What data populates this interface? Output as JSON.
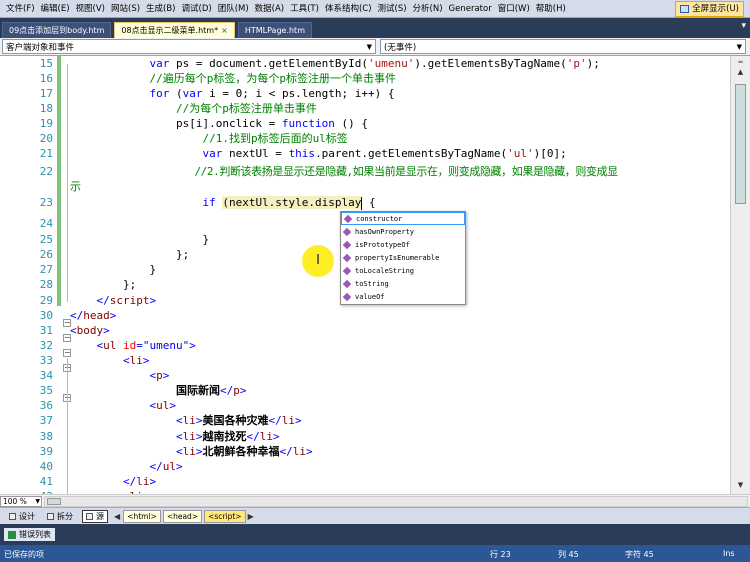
{
  "menubar": {
    "items": [
      "文件(F)",
      "编辑(E)",
      "视图(V)",
      "网站(S)",
      "生成(B)",
      "调试(D)",
      "团队(M)",
      "数据(A)",
      "工具(T)",
      "体系结构(C)",
      "测试(S)",
      "分析(N)",
      "Generator",
      "窗口(W)",
      "帮助(H)"
    ],
    "fullscreen_label": "全屏显示(U)"
  },
  "tabs": {
    "items": [
      {
        "label": "09点击添加层到body.htm"
      },
      {
        "label": "08点击显示二级菜单.htm*",
        "close": "×"
      },
      {
        "label": "HTMLPage.htm"
      }
    ],
    "right_icon": "▾"
  },
  "navbar": {
    "left": "客户端对象和事件",
    "right": "(无事件)"
  },
  "editor": {
    "line_numbers": [
      "15",
      "16",
      "17",
      "18",
      "19",
      "20",
      "21",
      "22",
      "",
      "23",
      "24",
      "25",
      "26",
      "27",
      "28",
      "29",
      "30",
      "31",
      "32",
      "33",
      "34",
      "35",
      "36",
      "37",
      "38",
      "39",
      "40",
      "41",
      "42"
    ],
    "lines": {
      "l15a": "            var ",
      "l15b": "ps = document.getElementById(",
      "l15c": "'umenu'",
      "l15d": ").getElementsByTagName(",
      "l15e": "'p'",
      "l15f": ");",
      "l16": "            //遍历每个p标签，为每个p标签注册一个单击事件",
      "l17a": "            for ",
      "l17b": "(",
      "l17c": "var ",
      "l17d": "i = 0; i < ps.length; i++) {",
      "l18": "                //为每个p标签注册单击事件",
      "l19a": "                ps[i].onclick = ",
      "l19b": "function ",
      "l19c": "() {",
      "l20": "                    //1.找到p标签后面的ul标签",
      "l21a": "                    var ",
      "l21b": "nextUl = ",
      "l21c": "this",
      "l21d": ".parent.getElementsByTagName(",
      "l21e": "'ul'",
      "l21f": ")[0];",
      "l22a": "                    //2.判断该表扬是显示还是隐藏,如果当前是显示在，则变成隐藏，如果是隐藏，则变成显",
      "l22b": "示",
      "l23a": "                    if ",
      "l23b": "(nextUl.style.display",
      "l23c": " {",
      "l24": "",
      "l25": "                    }",
      "l26": "                };",
      "l27": "            }",
      "l28": "        };",
      "l29a": "    </",
      "l29b": "script",
      "l29c": ">",
      "l30a": "</",
      "l30b": "head",
      "l30c": ">",
      "l31a": "<",
      "l31b": "body",
      "l31c": ">",
      "l32a": "    <",
      "l32b": "ul ",
      "l32c": "id",
      "l32d": "=\"umenu\"",
      "l32e": ">",
      "l33a": "        <",
      "l33b": "li",
      "l33c": ">",
      "l34a": "            <",
      "l34b": "p",
      "l34c": ">",
      "l35a": "                国际新闻",
      "l35b": "</",
      "l35c": "p",
      "l35d": ">",
      "l36a": "            <",
      "l36b": "ul",
      "l36c": ">",
      "l37a": "                <",
      "l37b": "li",
      "l37c": ">",
      "l37d": "美国各种灾难",
      "l37e": "</",
      "l37f": "li",
      "l37g": ">",
      "l38a": "                <",
      "l38b": "li",
      "l38c": ">",
      "l38d": "越南找死",
      "l38e": "</",
      "l38f": "li",
      "l38g": ">",
      "l39a": "                <",
      "l39b": "li",
      "l39c": ">",
      "l39d": "北朝鲜各种幸福",
      "l39e": "</",
      "l39f": "li",
      "l39g": ">",
      "l40a": "            </",
      "l40b": "ul",
      "l40c": ">",
      "l41a": "        </",
      "l41b": "li",
      "l41c": ">",
      "l42a": "        <",
      "l42b": "li",
      "l42c": ">"
    }
  },
  "autocomplete": {
    "items": [
      "constructor",
      "hasOwnProperty",
      "isPrototypeOf",
      "propertyIsEnumerable",
      "toLocaleString",
      "toString",
      "valueOf"
    ],
    "selected_index": 0
  },
  "cursor_marker": "I",
  "bottom": {
    "zoom": "100 %",
    "views": {
      "design": "设计",
      "split": "拆分",
      "source": "源"
    },
    "crumbs": [
      "<html>",
      "<head>",
      "<script>"
    ]
  },
  "error_list": "错误列表",
  "status": {
    "saved": "已保存的项",
    "row": "行 23",
    "col": "列 45",
    "char": "字符 45",
    "mode": "Ins"
  }
}
